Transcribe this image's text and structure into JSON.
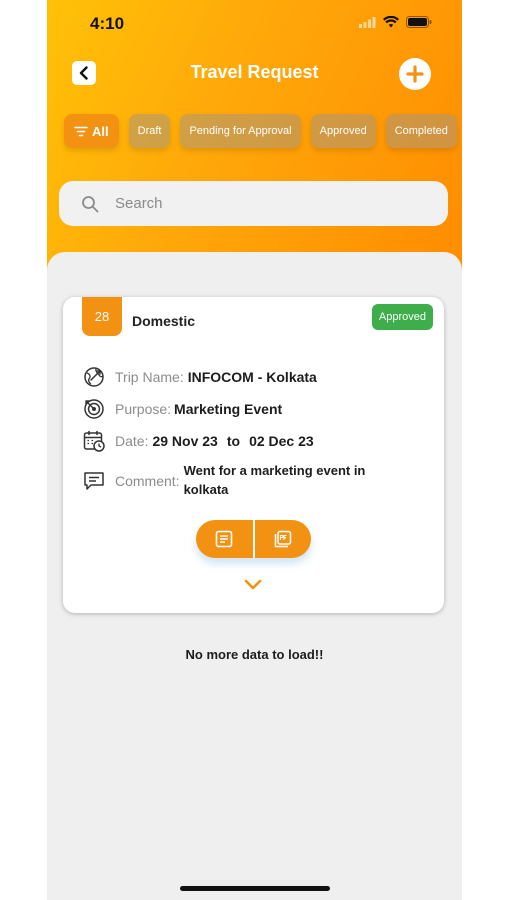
{
  "status_bar": {
    "time": "4:10"
  },
  "header": {
    "title": "Travel Request"
  },
  "filters": [
    {
      "label": "All"
    },
    {
      "label": "Draft"
    },
    {
      "label": "Pending for Approval"
    },
    {
      "label": "Approved"
    },
    {
      "label": "Completed"
    }
  ],
  "search": {
    "placeholder": "Search"
  },
  "card": {
    "day": "28",
    "trip_type": "Domestic",
    "status": "Approved",
    "trip_name_label": "Trip Name:",
    "trip_name": "INFOCOM - Kolkata",
    "purpose_label": "Purpose:",
    "purpose": "Marketing Event",
    "date_label": "Date:",
    "date_from": "29 Nov 23",
    "date_to_label": "to",
    "date_to": "02 Dec 23",
    "comment_label": "Comment:",
    "comment": "Went for a marketing event in kolkata"
  },
  "footer_text": "No more data to load!!",
  "colors": {
    "accent": "#f39212",
    "approved": "#3dae4a",
    "header_start": "#ffc107",
    "header_end": "#ff8c00"
  }
}
